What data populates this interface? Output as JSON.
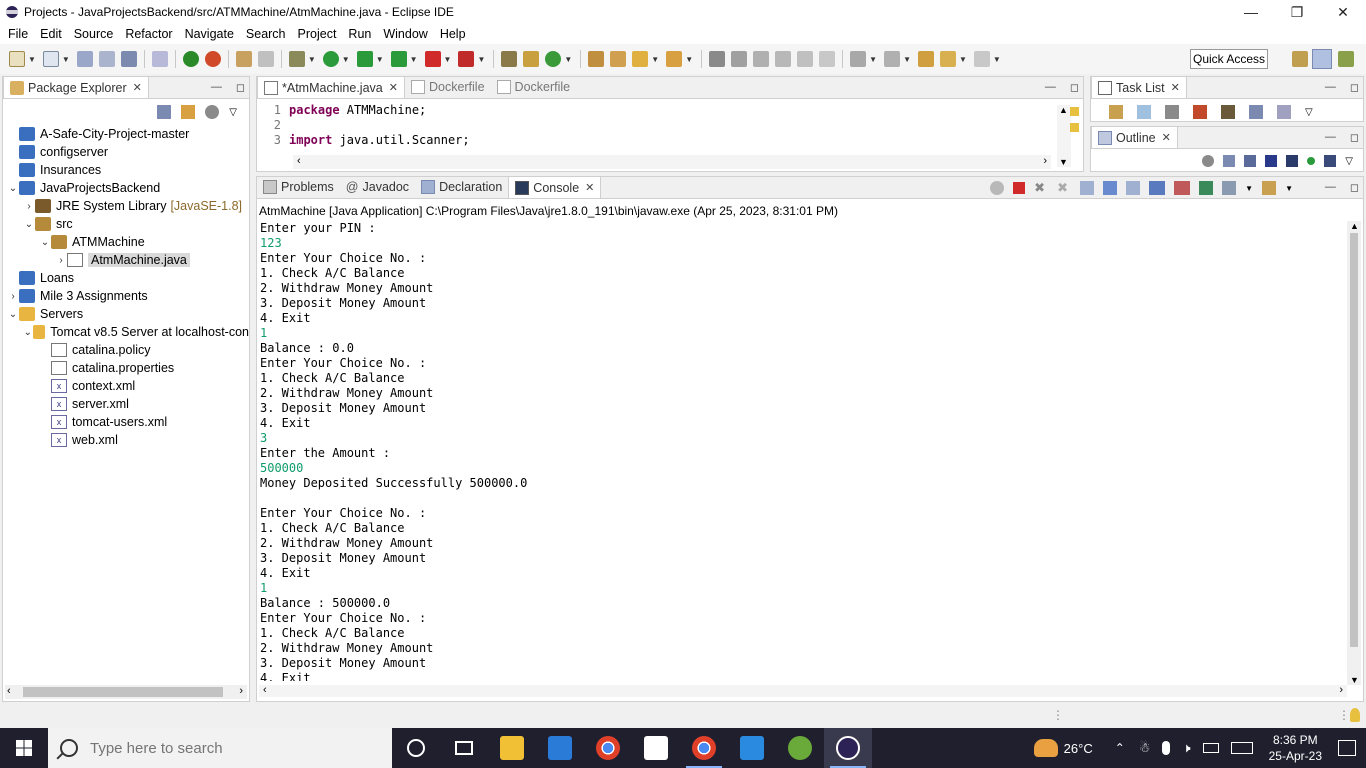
{
  "window": {
    "title": "Projects - JavaProjectsBackend/src/ATMMachine/AtmMachine.java - Eclipse IDE"
  },
  "menu": [
    "File",
    "Edit",
    "Source",
    "Refactor",
    "Navigate",
    "Search",
    "Project",
    "Run",
    "Window",
    "Help"
  ],
  "toolbar": {
    "quick_access": "Quick Access"
  },
  "package_explorer": {
    "title": "Package Explorer",
    "items": [
      {
        "label": "A-Safe-City-Project-master",
        "depth": 0,
        "arrow": "",
        "icon": "project-folder-icon"
      },
      {
        "label": "configserver",
        "depth": 0,
        "arrow": "",
        "icon": "project-folder-icon"
      },
      {
        "label": "Insurances",
        "depth": 0,
        "arrow": "",
        "icon": "project-folder-icon"
      },
      {
        "label": "JavaProjectsBackend",
        "depth": 0,
        "arrow": "⌄",
        "icon": "java-project-icon"
      },
      {
        "label": "JRE System Library",
        "suffix": "[JavaSE-1.8]",
        "depth": 1,
        "arrow": "›",
        "icon": "library-icon"
      },
      {
        "label": "src",
        "depth": 1,
        "arrow": "⌄",
        "icon": "source-folder-icon"
      },
      {
        "label": "ATMMachine",
        "depth": 2,
        "arrow": "⌄",
        "icon": "package-icon"
      },
      {
        "label": "AtmMachine.java",
        "depth": 3,
        "arrow": "›",
        "icon": "java-file-icon",
        "selected": true
      },
      {
        "label": "Loans",
        "depth": 0,
        "arrow": "",
        "icon": "project-folder-icon"
      },
      {
        "label": "Mile 3 Assignments",
        "depth": 0,
        "arrow": "›",
        "icon": "java-project-icon"
      },
      {
        "label": "Servers",
        "depth": 0,
        "arrow": "⌄",
        "icon": "folder-icon"
      },
      {
        "label": "Tomcat v8.5 Server at localhost-con",
        "depth": 1,
        "arrow": "⌄",
        "icon": "folder-icon"
      },
      {
        "label": "catalina.policy",
        "depth": 2,
        "arrow": "",
        "icon": "file-icon"
      },
      {
        "label": "catalina.properties",
        "depth": 2,
        "arrow": "",
        "icon": "file-icon"
      },
      {
        "label": "context.xml",
        "depth": 2,
        "arrow": "",
        "icon": "xml-file-icon"
      },
      {
        "label": "server.xml",
        "depth": 2,
        "arrow": "",
        "icon": "xml-file-icon"
      },
      {
        "label": "tomcat-users.xml",
        "depth": 2,
        "arrow": "",
        "icon": "xml-file-icon"
      },
      {
        "label": "web.xml",
        "depth": 2,
        "arrow": "",
        "icon": "xml-file-icon"
      }
    ]
  },
  "editor": {
    "tabs": [
      {
        "label": "*AtmMachine.java",
        "active": true
      },
      {
        "label": "Dockerfile",
        "active": false
      },
      {
        "label": "Dockerfile",
        "active": false
      }
    ],
    "lines": [
      {
        "n": "1",
        "kw": "package",
        "rest": " ATMMachine;"
      },
      {
        "n": "2",
        "kw": "",
        "rest": ""
      },
      {
        "n": "3",
        "kw": "import",
        "rest": " java.util.Scanner;"
      }
    ]
  },
  "task_list": {
    "title": "Task List"
  },
  "outline": {
    "title": "Outline"
  },
  "console": {
    "tabs": [
      {
        "label": "Problems",
        "active": false
      },
      {
        "label": "Javadoc",
        "active": false
      },
      {
        "label": "Declaration",
        "active": false
      },
      {
        "label": "Console",
        "active": true
      }
    ],
    "launch": "AtmMachine [Java Application] C:\\Program Files\\Java\\jre1.8.0_191\\bin\\javaw.exe (Apr 25, 2023, 8:31:01 PM)",
    "lines": [
      {
        "t": "Enter your PIN :",
        "input": false
      },
      {
        "t": "123",
        "input": true
      },
      {
        "t": "Enter Your Choice No. :",
        "input": false
      },
      {
        "t": "1. Check A/C Balance",
        "input": false
      },
      {
        "t": "2. Withdraw Money Amount",
        "input": false
      },
      {
        "t": "3. Deposit Money Amount",
        "input": false
      },
      {
        "t": "4. Exit",
        "input": false
      },
      {
        "t": "1",
        "input": true
      },
      {
        "t": "Balance : 0.0",
        "input": false
      },
      {
        "t": "Enter Your Choice No. :",
        "input": false
      },
      {
        "t": "1. Check A/C Balance",
        "input": false
      },
      {
        "t": "2. Withdraw Money Amount",
        "input": false
      },
      {
        "t": "3. Deposit Money Amount",
        "input": false
      },
      {
        "t": "4. Exit",
        "input": false
      },
      {
        "t": "3",
        "input": true
      },
      {
        "t": "Enter the Amount :",
        "input": false
      },
      {
        "t": "500000",
        "input": true
      },
      {
        "t": "Money Deposited Successfully 500000.0",
        "input": false
      },
      {
        "t": "",
        "input": false
      },
      {
        "t": "Enter Your Choice No. :",
        "input": false
      },
      {
        "t": "1. Check A/C Balance",
        "input": false
      },
      {
        "t": "2. Withdraw Money Amount",
        "input": false
      },
      {
        "t": "3. Deposit Money Amount",
        "input": false
      },
      {
        "t": "4. Exit",
        "input": false
      },
      {
        "t": "1",
        "input": true
      },
      {
        "t": "Balance : 500000.0",
        "input": false
      },
      {
        "t": "Enter Your Choice No. :",
        "input": false
      },
      {
        "t": "1. Check A/C Balance",
        "input": false
      },
      {
        "t": "2. Withdraw Money Amount",
        "input": false
      },
      {
        "t": "3. Deposit Money Amount",
        "input": false
      },
      {
        "t": "4. Exit",
        "input": false
      }
    ]
  },
  "taskbar": {
    "search_placeholder": "Type here to search",
    "temperature": "26°C",
    "time": "8:36 PM",
    "date": "25-Apr-23"
  }
}
